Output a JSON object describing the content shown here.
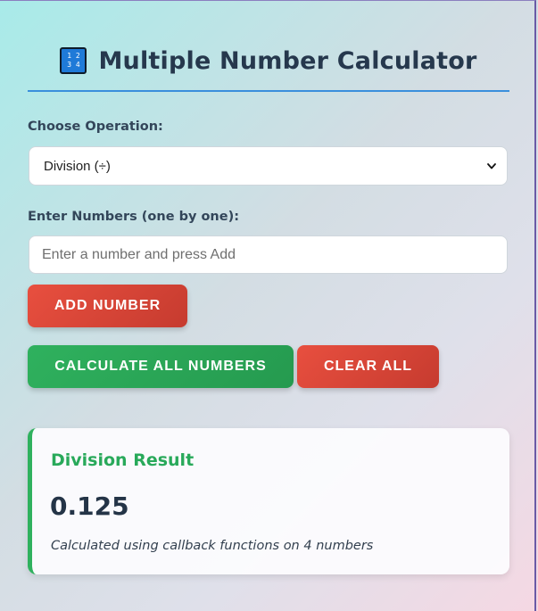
{
  "header": {
    "icon_top": "1 2",
    "icon_bottom": "3 4",
    "icon_name": "input-numbers-icon",
    "title": "Multiple Number Calculator"
  },
  "operation": {
    "label": "Choose Operation:",
    "selected": "Division (÷)"
  },
  "numbers": {
    "label": "Enter Numbers (one by one):",
    "input_value": "",
    "placeholder": "Enter a number and press Add"
  },
  "buttons": {
    "add": "ADD NUMBER",
    "calculate": "CALCULATE ALL NUMBERS",
    "clear": "CLEAR ALL"
  },
  "result": {
    "title": "Division Result",
    "value": "0.125",
    "note": "Calculated using callback functions on 4 numbers"
  },
  "colors": {
    "accent_blue": "#3a8fdc",
    "primary_red": "#e84f3f",
    "success_green": "#2fb15e",
    "title_text": "#26384d"
  }
}
